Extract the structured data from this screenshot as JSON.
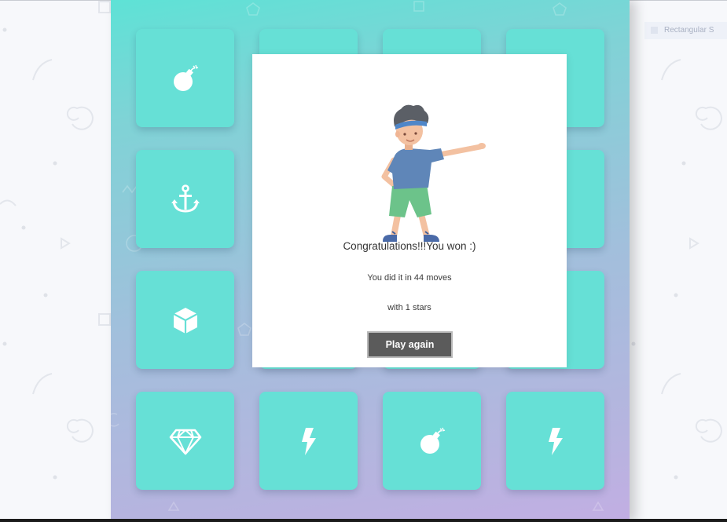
{
  "browser": {
    "ghost_tab_label": "Rectangular S"
  },
  "board": {
    "cards": [
      {
        "icon": "bomb-icon",
        "revealed": true
      },
      {
        "icon": "",
        "revealed": true
      },
      {
        "icon": "",
        "revealed": true
      },
      {
        "icon": "",
        "revealed": true
      },
      {
        "icon": "anchor-icon",
        "revealed": true
      },
      {
        "icon": "",
        "revealed": true
      },
      {
        "icon": "",
        "revealed": true
      },
      {
        "icon": "",
        "revealed": true
      },
      {
        "icon": "cube-icon",
        "revealed": true
      },
      {
        "icon": "",
        "revealed": true
      },
      {
        "icon": "",
        "revealed": true
      },
      {
        "icon": "",
        "revealed": true
      },
      {
        "icon": "diamond-icon",
        "revealed": true
      },
      {
        "icon": "bolt-icon",
        "revealed": true
      },
      {
        "icon": "bomb-icon",
        "revealed": true
      },
      {
        "icon": "bolt-icon",
        "revealed": true
      }
    ],
    "card_color": "#66e0d6",
    "icon_color": "#ffffff"
  },
  "modal": {
    "title": "Congratulations!!!You won :)",
    "moves_text": "You did it in 44 moves",
    "stars_text": "with 1 stars",
    "play_again_label": "Play again",
    "illustration": "dancing-boy-illustration"
  },
  "colors": {
    "gradient_top": "#5ee2d6",
    "gradient_bottom": "#c2aee3",
    "button_bg": "#5b5b5b"
  }
}
